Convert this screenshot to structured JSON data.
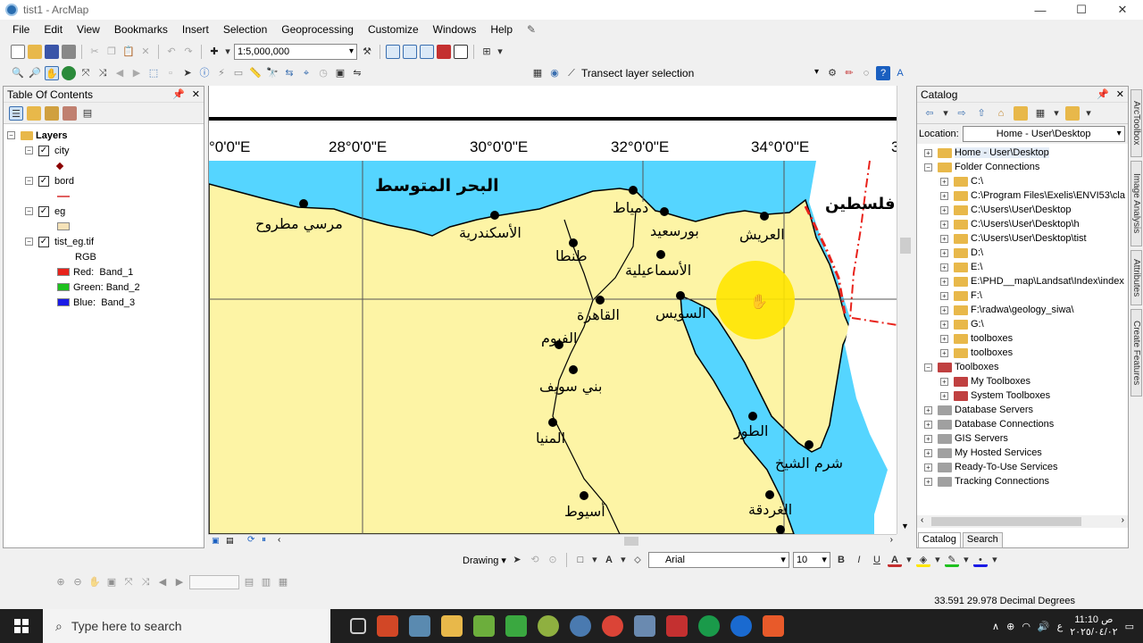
{
  "window": {
    "title": "tist1 - ArcMap",
    "min": "—",
    "max": "☐",
    "close": "✕"
  },
  "menu": [
    "File",
    "Edit",
    "View",
    "Bookmarks",
    "Insert",
    "Selection",
    "Geoprocessing",
    "Customize",
    "Windows",
    "Help"
  ],
  "toolbar": {
    "scale": "1:5,000,000",
    "transect_label": "Transect layer selection"
  },
  "toc": {
    "title": "Table Of Contents",
    "root": "Layers",
    "layers": [
      {
        "name": "city",
        "symbol": "point"
      },
      {
        "name": "bord",
        "symbol": "line"
      },
      {
        "name": "eg",
        "symbol": "polygon"
      },
      {
        "name": "tist_eg.tif",
        "symbol": "raster",
        "renderer": "RGB",
        "bands": [
          {
            "label": "Red:",
            "band": "Band_1",
            "color": "#e8231c"
          },
          {
            "label": "Green:",
            "band": "Band_2",
            "color": "#1fc11f"
          },
          {
            "label": "Blue:",
            "band": "Band_3",
            "color": "#1a1ae6"
          }
        ]
      }
    ]
  },
  "map": {
    "longitude_labels": [
      "°0'0\"E",
      "28°0'0\"E",
      "30°0'0\"E",
      "32°0'0\"E",
      "34°0'0\"E",
      "3"
    ],
    "sea_label": "البحر المتوسط",
    "palestine_label": "فلسطين",
    "cities": [
      "مرسي مطروح",
      "الأسكندرية",
      "طنطا",
      "دمياط",
      "بورسعيد",
      "العريش",
      "الأسماعيلية",
      "القاهرة",
      "السويس",
      "الفيوم",
      "بني سويف",
      "المنيا",
      "الطور",
      "شرم الشيخ",
      "الغردقة",
      "أسيوط"
    ],
    "colors": {
      "land": "#fdf4a5",
      "water": "#55d5ff"
    }
  },
  "catalog": {
    "title": "Catalog",
    "location_label": "Location:",
    "location_value": "Home - User\\Desktop",
    "items": [
      {
        "label": "Home - User\\Desktop",
        "level": 0,
        "type": "home"
      },
      {
        "label": "Folder Connections",
        "level": 0,
        "type": "folder",
        "expanded": true
      },
      {
        "label": "C:\\",
        "level": 1,
        "type": "folder"
      },
      {
        "label": "C:\\Program Files\\Exelis\\ENVI53\\cla",
        "level": 1,
        "type": "folder"
      },
      {
        "label": "C:\\Users\\User\\Desktop",
        "level": 1,
        "type": "folder"
      },
      {
        "label": "C:\\Users\\User\\Desktop\\h",
        "level": 1,
        "type": "folder"
      },
      {
        "label": "C:\\Users\\User\\Desktop\\tist",
        "level": 1,
        "type": "folder"
      },
      {
        "label": "D:\\",
        "level": 1,
        "type": "folder"
      },
      {
        "label": "E:\\",
        "level": 1,
        "type": "folder"
      },
      {
        "label": "E:\\PHD__map\\Landsat\\Index\\index",
        "level": 1,
        "type": "folder"
      },
      {
        "label": "F:\\",
        "level": 1,
        "type": "folder"
      },
      {
        "label": "F:\\radwa\\geology_siwa\\",
        "level": 1,
        "type": "folder"
      },
      {
        "label": "G:\\",
        "level": 1,
        "type": "folder"
      },
      {
        "label": "toolboxes",
        "level": 1,
        "type": "folder"
      },
      {
        "label": "toolboxes",
        "level": 1,
        "type": "folder"
      },
      {
        "label": "Toolboxes",
        "level": 0,
        "type": "toolbox",
        "expanded": true
      },
      {
        "label": "My Toolboxes",
        "level": 1,
        "type": "toolbox"
      },
      {
        "label": "System Toolboxes",
        "level": 1,
        "type": "toolbox"
      },
      {
        "label": "Database Servers",
        "level": 0,
        "type": "server"
      },
      {
        "label": "Database Connections",
        "level": 0,
        "type": "server"
      },
      {
        "label": "GIS Servers",
        "level": 0,
        "type": "server"
      },
      {
        "label": "My Hosted Services",
        "level": 0,
        "type": "server"
      },
      {
        "label": "Ready-To-Use Services",
        "level": 0,
        "type": "server"
      },
      {
        "label": "Tracking Connections",
        "level": 0,
        "type": "server"
      }
    ],
    "tabs": [
      "Catalog",
      "Search"
    ]
  },
  "sidetabs": [
    "ArcToolbox",
    "Image Analysis",
    "Attributes",
    "Create Features"
  ],
  "drawing": {
    "label": "Drawing ▾",
    "font": "Arial",
    "size": "10",
    "bold": "B",
    "italic": "I",
    "underline": "U"
  },
  "status": {
    "coords": "33.591  29.978 Decimal Degrees"
  },
  "taskbar": {
    "search_placeholder": "Type here to search",
    "time": "11:10 ص",
    "date": "٢٠٢٥/٠٤/٠٢",
    "lang": "ع"
  }
}
